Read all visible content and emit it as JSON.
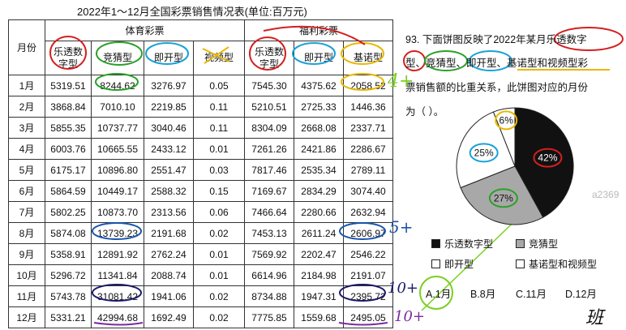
{
  "table": {
    "title": "2022年1～12月全国彩票销售情况表(单位:百万元)",
    "col_month": "月份",
    "group_sports": "体育彩票",
    "group_welfare": "福利彩票",
    "sub_cols": [
      "乐透数字型",
      "竞猜型",
      "即开型",
      "视频型",
      "乐透数字型",
      "即开型",
      "基诺型"
    ],
    "rows": [
      {
        "month": "1月",
        "v": [
          "5319.51",
          "8244.62",
          "3276.97",
          "0.05",
          "7545.30",
          "4375.62",
          "2058.52"
        ]
      },
      {
        "month": "2月",
        "v": [
          "3868.84",
          "7010.10",
          "2219.85",
          "0.11",
          "5210.51",
          "2725.33",
          "1446.36"
        ]
      },
      {
        "month": "3月",
        "v": [
          "5855.35",
          "10737.77",
          "3040.46",
          "0.11",
          "8304.09",
          "2668.08",
          "2337.71"
        ]
      },
      {
        "month": "4月",
        "v": [
          "6003.76",
          "10665.55",
          "2433.12",
          "0.01",
          "7261.26",
          "2421.86",
          "2286.67"
        ]
      },
      {
        "month": "5月",
        "v": [
          "6175.17",
          "10896.80",
          "2551.47",
          "0.03",
          "7817.46",
          "2535.34",
          "2789.11"
        ]
      },
      {
        "month": "6月",
        "v": [
          "5864.59",
          "10449.17",
          "2588.32",
          "0.15",
          "7169.67",
          "2834.29",
          "3074.40"
        ]
      },
      {
        "month": "7月",
        "v": [
          "5802.25",
          "10873.70",
          "2313.56",
          "0.06",
          "7466.64",
          "2280.66",
          "2632.94"
        ]
      },
      {
        "month": "8月",
        "v": [
          "5874.08",
          "13739.23",
          "2191.68",
          "0.02",
          "7453.13",
          "2611.24",
          "2606.97"
        ]
      },
      {
        "month": "9月",
        "v": [
          "5358.91",
          "12891.92",
          "2762.24",
          "0.01",
          "7569.92",
          "2202.47",
          "2546.22"
        ]
      },
      {
        "month": "10月",
        "v": [
          "5296.72",
          "11341.84",
          "2088.74",
          "0.01",
          "6614.96",
          "2184.98",
          "2191.07"
        ]
      },
      {
        "month": "11月",
        "v": [
          "5743.78",
          "31081.42",
          "1941.06",
          "0.02",
          "8734.88",
          "1947.31",
          "2395.72"
        ]
      },
      {
        "month": "12月",
        "v": [
          "5331.21",
          "42994.68",
          "1692.49",
          "0.02",
          "7775.85",
          "1559.68",
          "2495.05"
        ]
      }
    ]
  },
  "question": {
    "line1": "93. 下面饼图反映了2022年某月乐透数字",
    "line2": "型、竞猜型、即开型、基诺型和视频型彩",
    "line3": "票销售额的比重关系，此饼图对应的月份",
    "line4": "为（ ）。"
  },
  "chart_data": {
    "type": "pie",
    "categories": [
      "乐透数字型",
      "竞猜型",
      "即开型",
      "基诺型和视频型"
    ],
    "values": [
      42,
      27,
      25,
      6
    ],
    "labels": [
      "42%",
      "27%",
      "25%",
      "6%"
    ],
    "colors": [
      "#111111",
      "#a8a8a8",
      "#ffffff",
      "#ffffff"
    ],
    "legend_position": "bottom"
  },
  "options": [
    "A.1月",
    "B.8月",
    "C.11月",
    "D.12月"
  ],
  "annotations": {
    "row1": "4+",
    "row8": "5+",
    "row11": "10+",
    "row12": "10+",
    "signature": "班"
  },
  "watermark": "a2369"
}
